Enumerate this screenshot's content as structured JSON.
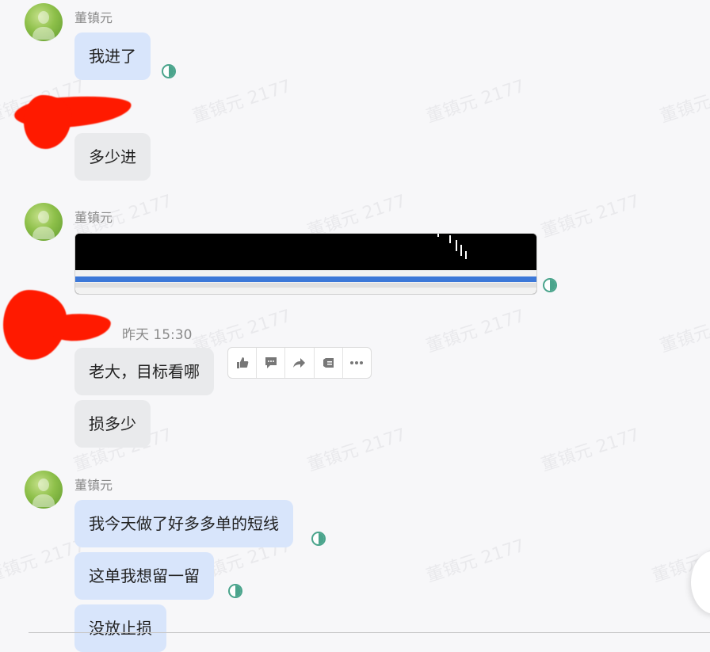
{
  "messages": {
    "group1": {
      "sender": "董镇元",
      "text": "我进了"
    },
    "group2": {
      "text": "多少进"
    },
    "group3": {
      "sender": "董镇元"
    },
    "group4": {
      "time": "昨天 15:30",
      "texts": [
        "老大，目标看哪",
        "损多少"
      ]
    },
    "group5": {
      "sender": "董镇元",
      "texts": [
        "我今天做了好多多单的短线",
        "这单我想留一留",
        "没放止损"
      ]
    }
  },
  "watermark": "董镇元 2177",
  "toolbar": {
    "icons": [
      "thumbs-up-icon",
      "comment-icon",
      "forward-icon",
      "quote-icon",
      "more-icon"
    ]
  },
  "colors": {
    "blue_bubble": "#d8e5fb",
    "gray_bubble": "#e9eaec",
    "read_icon": "#4aa48c",
    "redaction": "#ff1a00"
  }
}
